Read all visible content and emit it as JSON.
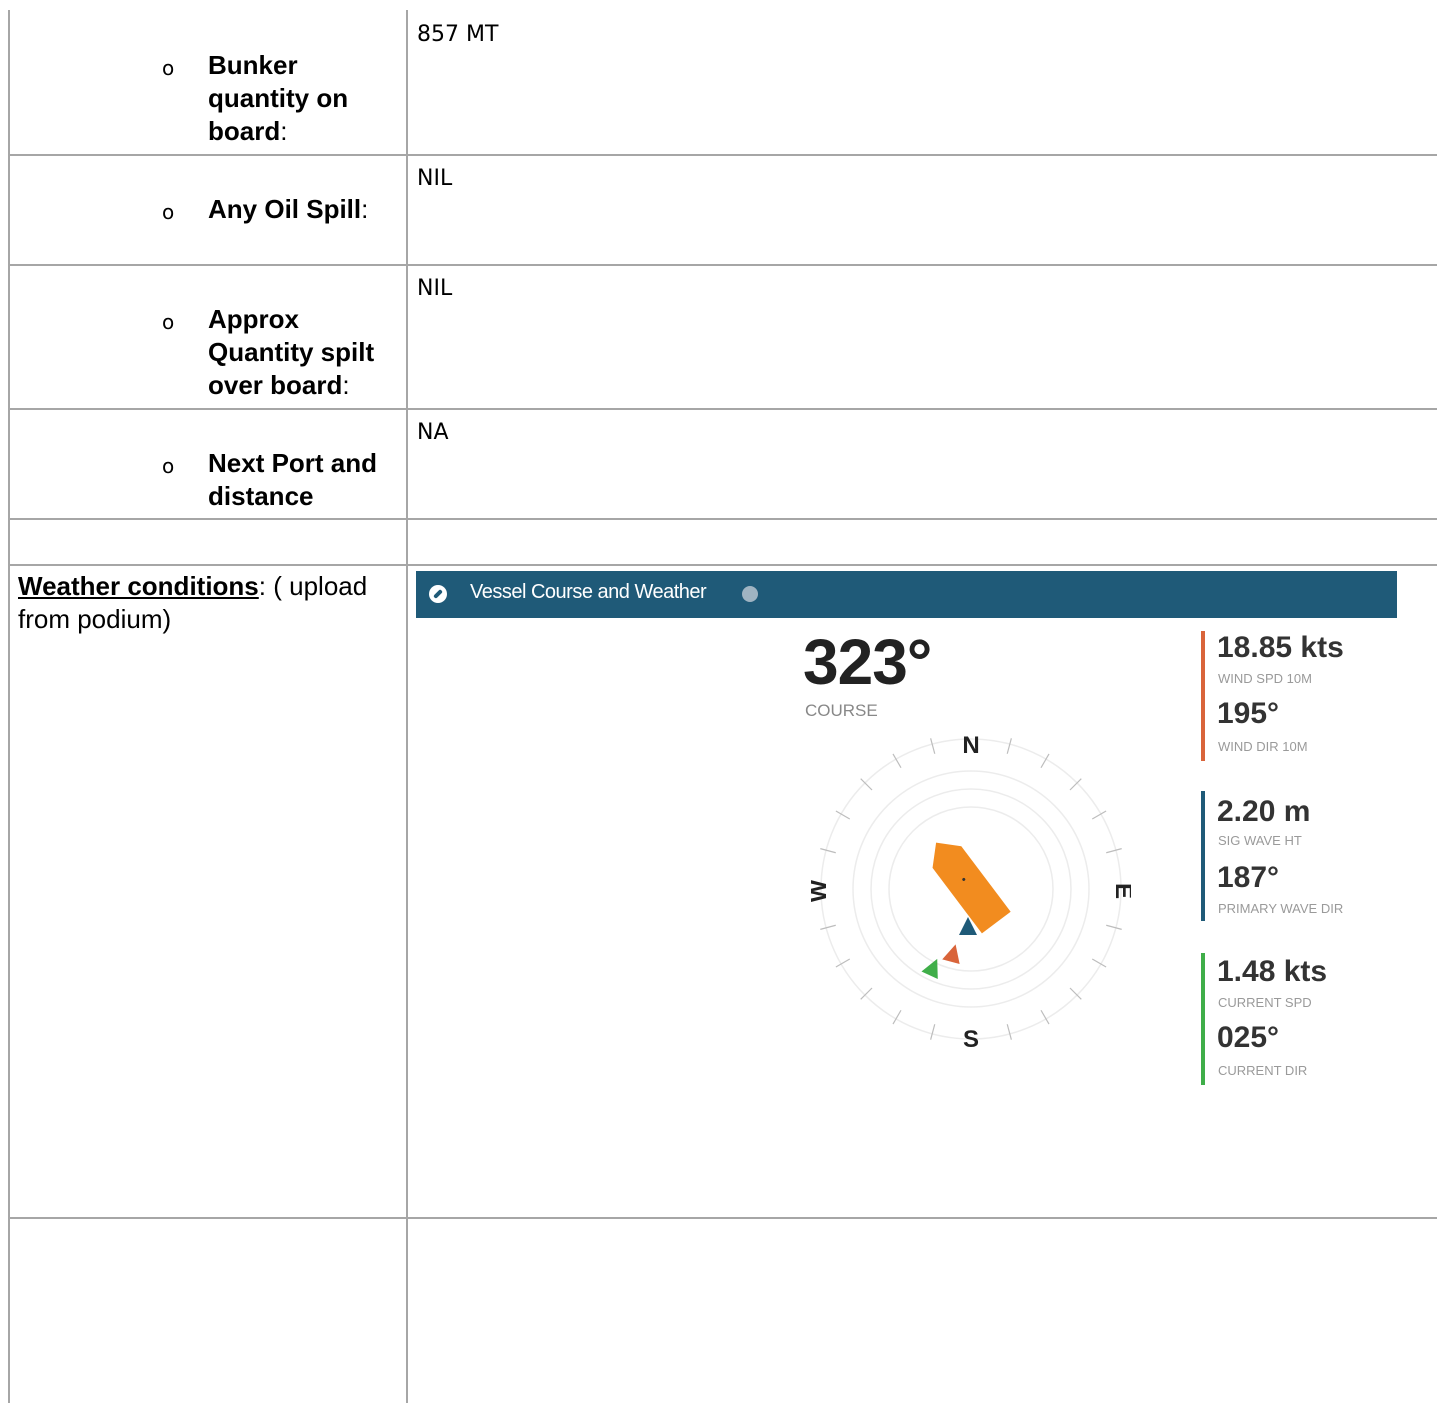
{
  "rows": [
    {
      "label": "Bunker quantity on board",
      "colon": ":",
      "value": "857 MT"
    },
    {
      "label": "Any Oil Spill",
      "colon": ":",
      "value": "NIL"
    },
    {
      "label": "Approx Quantity spilt over board",
      "colon": ":",
      "value": "NIL"
    },
    {
      "label": "Next Port and distance",
      "colon": "",
      "value": "NA"
    }
  ],
  "bullet_char": "o",
  "weather": {
    "label": "Weather conditions",
    "colon": ":",
    "note": "  ( upload from podium)"
  },
  "widget": {
    "title": "Vessel Course and Weather",
    "course": "323°",
    "course_label": "COURSE",
    "compass_labels": {
      "n": "N",
      "e": "E",
      "s": "S",
      "w": "W"
    },
    "vessel_heading_deg": 323,
    "metrics": [
      {
        "color": "#d9643a",
        "items": [
          {
            "value": "18.85 kts",
            "label": "WIND SPD 10M"
          },
          {
            "value": "195°",
            "label": "WIND DIR 10M"
          }
        ]
      },
      {
        "color": "#1f5a78",
        "items": [
          {
            "value": "2.20 m",
            "label": "SIG WAVE HT"
          },
          {
            "value": "187°",
            "label": "PRIMARY WAVE DIR"
          }
        ]
      },
      {
        "color": "#3fae49",
        "items": [
          {
            "value": "1.48 kts",
            "label": "CURRENT SPD"
          },
          {
            "value": "025°",
            "label": "CURRENT DIR"
          }
        ]
      }
    ],
    "colors": {
      "header": "#1f5a78",
      "vessel": "#f28c1f",
      "wind": "#d9643a",
      "wave": "#1f5a78",
      "current": "#3fae49"
    }
  }
}
